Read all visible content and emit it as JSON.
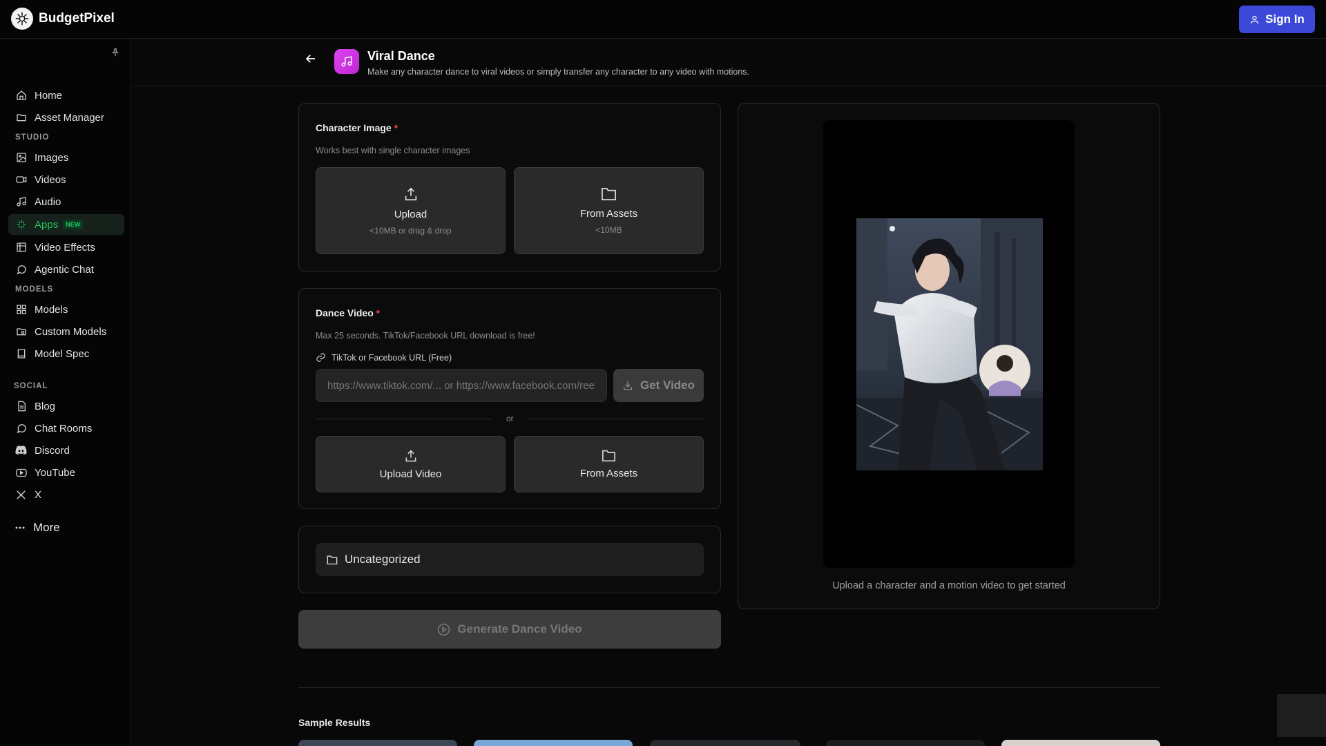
{
  "topbar": {
    "brand": "BudgetPixel",
    "sign_in": "Sign In"
  },
  "sidebar": {
    "items_top": [
      {
        "label": "Home",
        "icon": "home-icon"
      },
      {
        "label": "Asset Manager",
        "icon": "folder-icon"
      }
    ],
    "studio_heading": "STUDIO",
    "studio": [
      {
        "label": "Images",
        "icon": "image-icon"
      },
      {
        "label": "Videos",
        "icon": "video-icon"
      },
      {
        "label": "Audio",
        "icon": "music-icon"
      },
      {
        "label": "Apps",
        "icon": "sparkle-icon",
        "badge": "NEW",
        "active": true
      },
      {
        "label": "Video Effects",
        "icon": "film-icon"
      },
      {
        "label": "Agentic Chat",
        "icon": "chat-icon"
      }
    ],
    "models_heading": "MODELS",
    "models": [
      {
        "label": "Models",
        "icon": "grid-icon"
      },
      {
        "label": "Custom Models",
        "icon": "folder-search-icon"
      },
      {
        "label": "Model Spec",
        "icon": "book-icon"
      }
    ],
    "social_heading": "SOCIAL",
    "social": [
      {
        "label": "Blog",
        "icon": "document-icon"
      },
      {
        "label": "Chat Rooms",
        "icon": "chat-icon"
      },
      {
        "label": "Discord",
        "icon": "discord-icon"
      },
      {
        "label": "YouTube",
        "icon": "youtube-icon"
      },
      {
        "label": "X",
        "icon": "x-icon"
      }
    ],
    "more": "More"
  },
  "header": {
    "title": "Viral Dance",
    "description": "Make any character dance to viral videos or simply transfer any character to any video with motions."
  },
  "character": {
    "label": "Character Image",
    "required_mark": "*",
    "hint": "Works best with single character images",
    "upload_title": "Upload",
    "upload_sub": "<10MB or drag & drop",
    "assets_title": "From Assets",
    "assets_sub": "<10MB"
  },
  "dance": {
    "label": "Dance Video",
    "required_mark": "*",
    "hint": "Max 25 seconds. TikTok/Facebook URL download is free!",
    "url_label": "TikTok or Facebook URL (Free)",
    "url_placeholder": "https://www.tiktok.com/... or https://www.facebook.com/reel/...",
    "get_video": "Get Video",
    "or": "or",
    "upload_video": "Upload Video",
    "from_assets": "From Assets"
  },
  "category": {
    "label": "Uncategorized"
  },
  "generate": {
    "label": "Generate Dance Video"
  },
  "preview": {
    "caption": "Upload a character and a motion video to get started"
  },
  "samples": {
    "heading": "Sample Results"
  },
  "colors": {
    "accent": "#3b48d8",
    "active_green": "#22c55e",
    "app_icon": "#d946ef",
    "required": "#ef4444"
  }
}
